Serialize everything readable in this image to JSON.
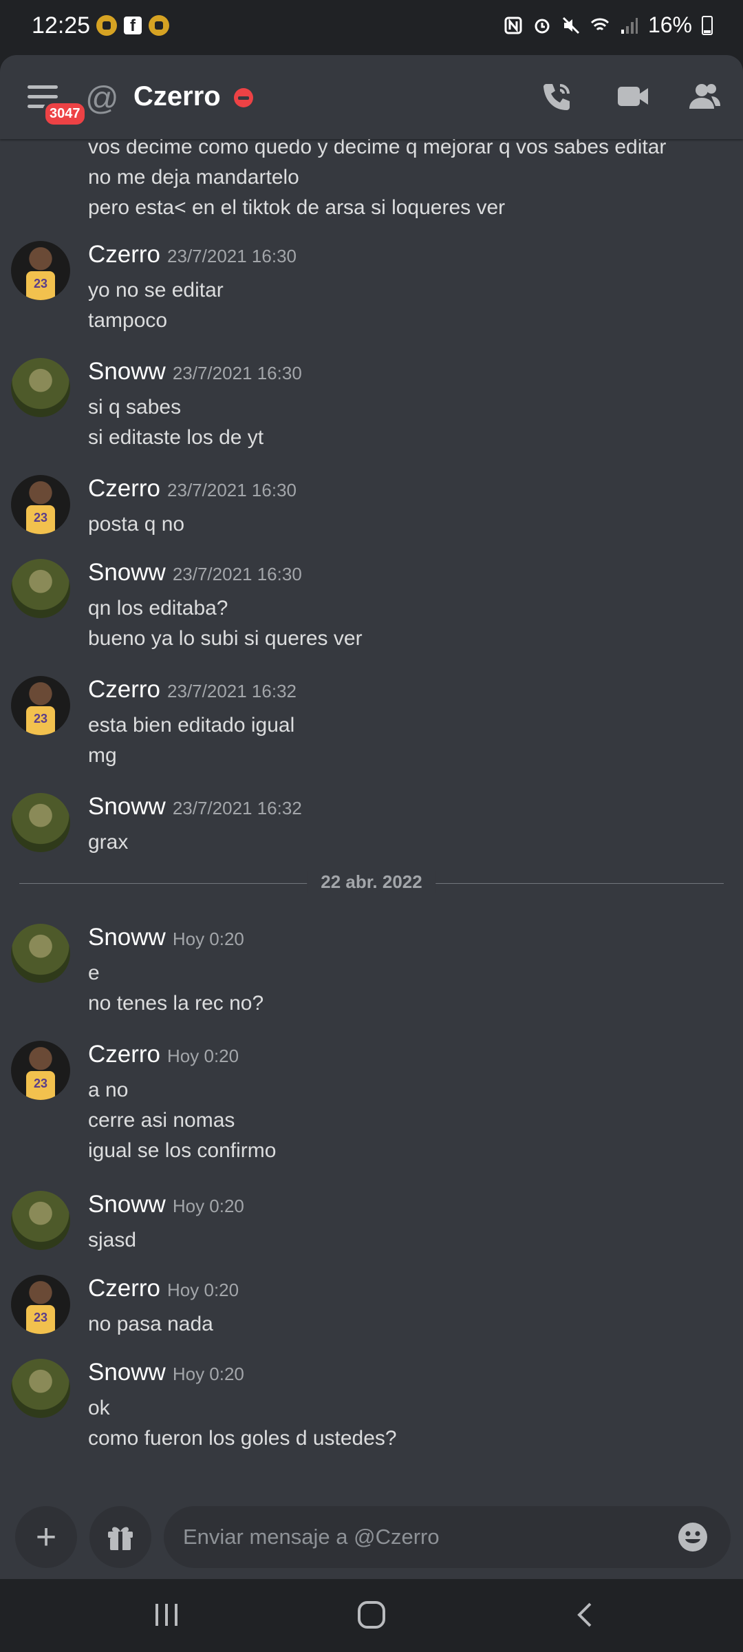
{
  "status": {
    "time": "12:25",
    "battery": "16%"
  },
  "header": {
    "title": "Czerro",
    "badge": "3047"
  },
  "top_lines": [
    "vos decime como quedo y decime q mejorar q vos sabes editar",
    "no  me deja mandartelo",
    "pero esta< en el tiktok de arsa si loqueres ver"
  ],
  "messages": [
    {
      "author": "Czerro",
      "time": "23/7/2021 16:30",
      "lines": [
        "yo no se editar",
        "tampoco"
      ]
    },
    {
      "author": "Snoww",
      "time": "23/7/2021 16:30",
      "lines": [
        "si q sabes",
        "si editaste los de yt"
      ]
    },
    {
      "author": "Czerro",
      "time": "23/7/2021 16:30",
      "lines": [
        "posta q no"
      ]
    },
    {
      "author": "Snoww",
      "time": "23/7/2021 16:30",
      "lines": [
        "qn los editaba?",
        "bueno ya lo subi si queres ver"
      ]
    },
    {
      "author": "Czerro",
      "time": "23/7/2021 16:32",
      "lines": [
        "esta bien editado igual",
        "mg"
      ]
    },
    {
      "author": "Snoww",
      "time": "23/7/2021 16:32",
      "lines": [
        "grax"
      ]
    },
    {
      "author": "Snoww",
      "time": "Hoy 0:20",
      "lines": [
        "e",
        "no tenes la rec no?"
      ]
    },
    {
      "author": "Czerro",
      "time": "Hoy 0:20",
      "lines": [
        "a no",
        "cerre asi nomas",
        "igual se los confirmo"
      ]
    },
    {
      "author": "Snoww",
      "time": "Hoy 0:20",
      "lines": [
        "sjasd"
      ]
    },
    {
      "author": "Czerro",
      "time": "Hoy 0:20",
      "lines": [
        "no pasa nada"
      ]
    },
    {
      "author": "Snoww",
      "time": "Hoy 0:20",
      "lines": [
        "ok",
        "como fueron los goles d ustedes?"
      ]
    }
  ],
  "date_divider": "22 abr. 2022",
  "composer": {
    "placeholder": "Enviar mensaje a @Czerro"
  },
  "icons": {
    "menu": "hamburger-icon",
    "at": "at-icon",
    "status": "dnd-icon",
    "call": "phone-call-icon",
    "video": "video-camera-icon",
    "members": "members-icon",
    "plus": "plus-icon",
    "gift": "gift-icon",
    "emoji": "emoji-icon"
  },
  "colors": {
    "background": "#36393f",
    "input": "#2f3136",
    "bar": "#202225",
    "accent_red": "#ed4245"
  }
}
